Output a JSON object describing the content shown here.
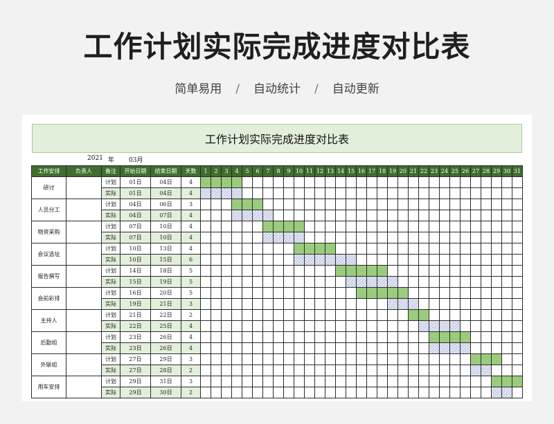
{
  "hero": {
    "title": "工作计划实际完成进度对比表",
    "tags": [
      "简单易用",
      "自动统计",
      "自动更新"
    ],
    "separator": "/"
  },
  "sheet": {
    "title": "工作计划实际完成进度对比表",
    "year": "2021",
    "year_label": "年",
    "month": "03月"
  },
  "colors": {
    "header_bg": "#3f6e2e",
    "plan_bar": "#9bcb7d",
    "actual_bar_hatch": "#b8c0df",
    "title_bg": "#e2efda"
  },
  "table": {
    "headers": [
      "工作安排",
      "负责人",
      "备注",
      "开始日期",
      "结束日期",
      "天数"
    ],
    "days": [
      "1",
      "2",
      "3",
      "4",
      "5",
      "6",
      "7",
      "8",
      "9",
      "10",
      "11",
      "12",
      "13",
      "14",
      "15",
      "16",
      "17",
      "18",
      "19",
      "20",
      "21",
      "22",
      "23",
      "24",
      "25",
      "26",
      "27",
      "28",
      "29",
      "30",
      "31"
    ],
    "tasks": [
      {
        "name": "研讨",
        "owner": "",
        "plan": {
          "label": "计划",
          "start": "01日",
          "end": "04日",
          "days": "4",
          "s": 1,
          "e": 4
        },
        "actual": {
          "label": "实际",
          "start": "01日",
          "end": "04日",
          "days": "4",
          "s": 1,
          "e": 4
        }
      },
      {
        "name": "人员分工",
        "owner": "",
        "plan": {
          "label": "计划",
          "start": "04日",
          "end": "06日",
          "days": "3",
          "s": 4,
          "e": 6
        },
        "actual": {
          "label": "实际",
          "start": "04日",
          "end": "07日",
          "days": "4",
          "s": 4,
          "e": 7
        }
      },
      {
        "name": "物资采购",
        "owner": "",
        "plan": {
          "label": "计划",
          "start": "07日",
          "end": "10日",
          "days": "4",
          "s": 7,
          "e": 10
        },
        "actual": {
          "label": "实际",
          "start": "07日",
          "end": "10日",
          "days": "4",
          "s": 7,
          "e": 10
        }
      },
      {
        "name": "会议选址",
        "owner": "",
        "plan": {
          "label": "计划",
          "start": "10日",
          "end": "13日",
          "days": "4",
          "s": 10,
          "e": 13
        },
        "actual": {
          "label": "实际",
          "start": "10日",
          "end": "15日",
          "days": "6",
          "s": 10,
          "e": 15
        }
      },
      {
        "name": "报告撰写",
        "owner": "",
        "plan": {
          "label": "计划",
          "start": "14日",
          "end": "18日",
          "days": "5",
          "s": 14,
          "e": 18
        },
        "actual": {
          "label": "实际",
          "start": "15日",
          "end": "19日",
          "days": "5",
          "s": 15,
          "e": 19
        }
      },
      {
        "name": "会前彩排",
        "owner": "",
        "plan": {
          "label": "计划",
          "start": "16日",
          "end": "20日",
          "days": "5",
          "s": 16,
          "e": 20
        },
        "actual": {
          "label": "实际",
          "start": "19日",
          "end": "21日",
          "days": "3",
          "s": 19,
          "e": 21
        }
      },
      {
        "name": "主持人",
        "owner": "",
        "plan": {
          "label": "计划",
          "start": "21日",
          "end": "22日",
          "days": "2",
          "s": 21,
          "e": 22
        },
        "actual": {
          "label": "实际",
          "start": "22日",
          "end": "25日",
          "days": "4",
          "s": 22,
          "e": 25
        }
      },
      {
        "name": "后勤组",
        "owner": "",
        "plan": {
          "label": "计划",
          "start": "23日",
          "end": "26日",
          "days": "4",
          "s": 23,
          "e": 26
        },
        "actual": {
          "label": "实际",
          "start": "23日",
          "end": "26日",
          "days": "4",
          "s": 23,
          "e": 26
        }
      },
      {
        "name": "外联组",
        "owner": "",
        "plan": {
          "label": "计划",
          "start": "27日",
          "end": "29日",
          "days": "3",
          "s": 27,
          "e": 29
        },
        "actual": {
          "label": "实际",
          "start": "27日",
          "end": "28日",
          "days": "2",
          "s": 27,
          "e": 28
        }
      },
      {
        "name": "用车安排",
        "owner": "",
        "plan": {
          "label": "计划",
          "start": "29日",
          "end": "31日",
          "days": "3",
          "s": 29,
          "e": 31
        },
        "actual": {
          "label": "实际",
          "start": "29日",
          "end": "30日",
          "days": "2",
          "s": 29,
          "e": 30
        }
      }
    ]
  }
}
